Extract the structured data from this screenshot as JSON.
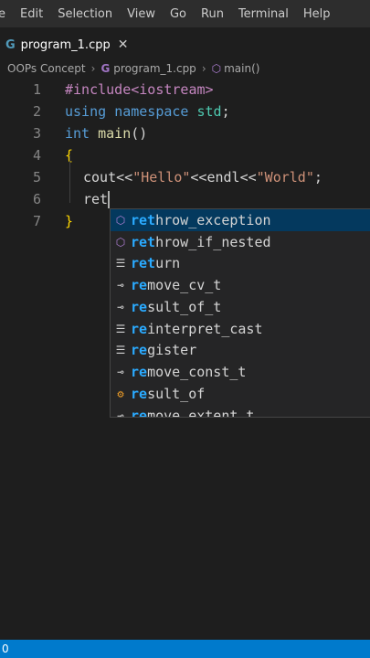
{
  "menubar": {
    "items": [
      "e",
      "Edit",
      "Selection",
      "View",
      "Go",
      "Run",
      "Terminal",
      "Help"
    ]
  },
  "tab": {
    "title": "program_1.cpp",
    "close": "✕",
    "icon": "C-cpp-icon"
  },
  "breadcrumb": {
    "folder": "OOPs Concept",
    "file": "program_1.cpp",
    "symbol": "main()"
  },
  "editor": {
    "lines": [
      {
        "num": "1",
        "text": "#include<iostream>"
      },
      {
        "num": "2",
        "text": "using namespace std;"
      },
      {
        "num": "3",
        "text": "int main()"
      },
      {
        "num": "4",
        "text": "{"
      },
      {
        "num": "5",
        "text": "cout<<\"Hello\"<<endl<<\"World\";"
      },
      {
        "num": "6",
        "text": "ret"
      },
      {
        "num": "7",
        "text": "}"
      }
    ]
  },
  "suggestions": [
    {
      "match": "ret",
      "rest": "hrow_exception",
      "icon": "cube-icon"
    },
    {
      "match": "ret",
      "rest": "hrow_if_nested",
      "icon": "cube-icon"
    },
    {
      "match": "ret",
      "rest": "urn",
      "icon": "keyword-icon"
    },
    {
      "match": "re",
      "rest": "move_cv_t",
      "icon": "snippet-icon"
    },
    {
      "match": "re",
      "rest": "sult_of_t",
      "icon": "snippet-icon"
    },
    {
      "match": "re",
      "rest": "interpret_cast",
      "icon": "keyword-icon"
    },
    {
      "match": "re",
      "rest": "gister",
      "icon": "keyword-icon"
    },
    {
      "match": "re",
      "rest": "move_const_t",
      "icon": "snippet-icon"
    },
    {
      "match": "re",
      "rest": "sult_of",
      "icon": "class-icon"
    },
    {
      "match": "re",
      "rest": "move_extent_t",
      "icon": "snippet-icon"
    }
  ],
  "statusbar": {
    "left": "0"
  }
}
